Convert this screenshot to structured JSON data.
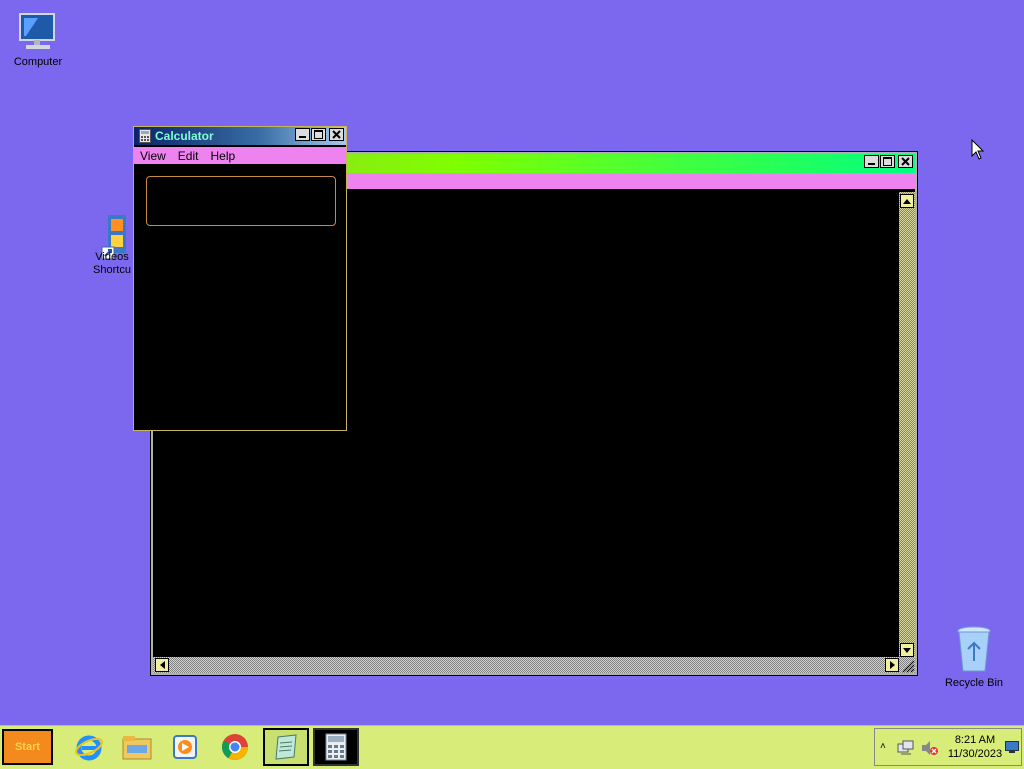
{
  "desktop": {
    "icons": {
      "computer": "Computer",
      "videos": "Videos\nShortcu",
      "videos_line1": "Videos",
      "videos_line2": "Shortcu",
      "recycle": "Recycle Bin"
    }
  },
  "calculator": {
    "title": "Calculator",
    "menu": [
      "View",
      "Edit",
      "Help"
    ],
    "display_value": ""
  },
  "taskbar": {
    "start_label": "Start",
    "apps": [
      "internet-explorer",
      "file-explorer",
      "media-player",
      "chrome",
      "notepad",
      "calculator"
    ]
  },
  "tray": {
    "time": "8:21 AM",
    "date": "11/30/2023"
  },
  "colors": {
    "desktop": "#7b68ee",
    "menubar": "#ee82ee",
    "taskbar": "#d8ec7a",
    "start": "#f28a1e"
  }
}
